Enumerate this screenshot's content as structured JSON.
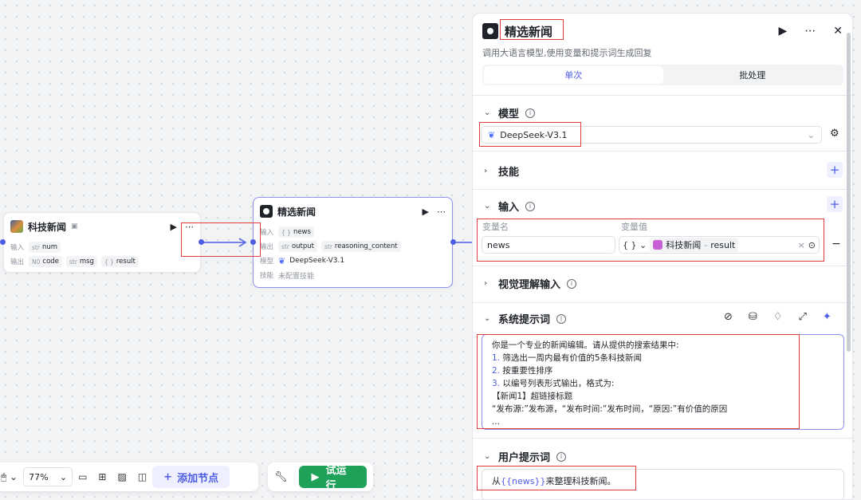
{
  "node1": {
    "title": "科技新闻",
    "input_label": "输入",
    "output_label": "输出",
    "inputs": [
      {
        "type": "str",
        "name": "num"
      }
    ],
    "outputs": [
      {
        "type": "N0",
        "name": "code"
      },
      {
        "type": "str",
        "name": "msg"
      },
      {
        "type": "{ }",
        "name": "result"
      }
    ]
  },
  "node2": {
    "title": "精选新闻",
    "input_label": "输入",
    "output_label": "输出",
    "model_label": "模型",
    "skill_label": "技能",
    "inputs": [
      {
        "type": "{ }",
        "name": "news"
      }
    ],
    "outputs": [
      {
        "type": "str",
        "name": "output"
      },
      {
        "type": "str",
        "name": "reasoning_content"
      }
    ],
    "model": "DeepSeek-V3.1",
    "skill": "未配置技能"
  },
  "toolbar": {
    "zoom": "77%",
    "add_node": "添加节点",
    "test_run": "试运行"
  },
  "panel": {
    "title": "精选新闻",
    "description": "调用大语言模型,使用变量和提示词生成回复",
    "tabs": [
      {
        "label": "单次",
        "active": true
      },
      {
        "label": "批处理",
        "active": false
      }
    ],
    "model_section": "模型",
    "model_value": "DeepSeek-V3.1",
    "skills_section": "技能",
    "input_section": "输入",
    "var_name_header": "变量名",
    "var_value_header": "变量值",
    "var_name": "news",
    "var_type": "{ }",
    "var_ref_node": "科技新闻",
    "var_ref_sep": " - ",
    "var_ref_field": "result",
    "vision_section": "视觉理解输入",
    "system_prompt_section": "系统提示词",
    "system_prompt_lines": [
      {
        "num": "",
        "text": "你是一个专业的新闻编辑。请从提供的搜索结果中:"
      },
      {
        "num": "1.",
        "text": " 筛选出一周内最有价值的5条科技新闻"
      },
      {
        "num": "2.",
        "text": " 按重要性排序"
      },
      {
        "num": "3.",
        "text": " 以编号列表形式输出，格式为:"
      },
      {
        "num": "",
        "text": "【新闻1】超链接标题"
      },
      {
        "num": "",
        "text": "“发布源:”发布源，“发布时间:”发布时间，“原因:”有价值的原因"
      },
      {
        "num": "",
        "text": "..."
      }
    ],
    "user_prompt_section": "用户提示词",
    "user_prompt_prefix": "从",
    "user_prompt_var": "{{news}}",
    "user_prompt_suffix": "来整理科技新闻。"
  },
  "colors": {
    "accent": "#4e5ee4",
    "run_green": "#1ea25a",
    "highlight_red": "#e23b3b"
  }
}
